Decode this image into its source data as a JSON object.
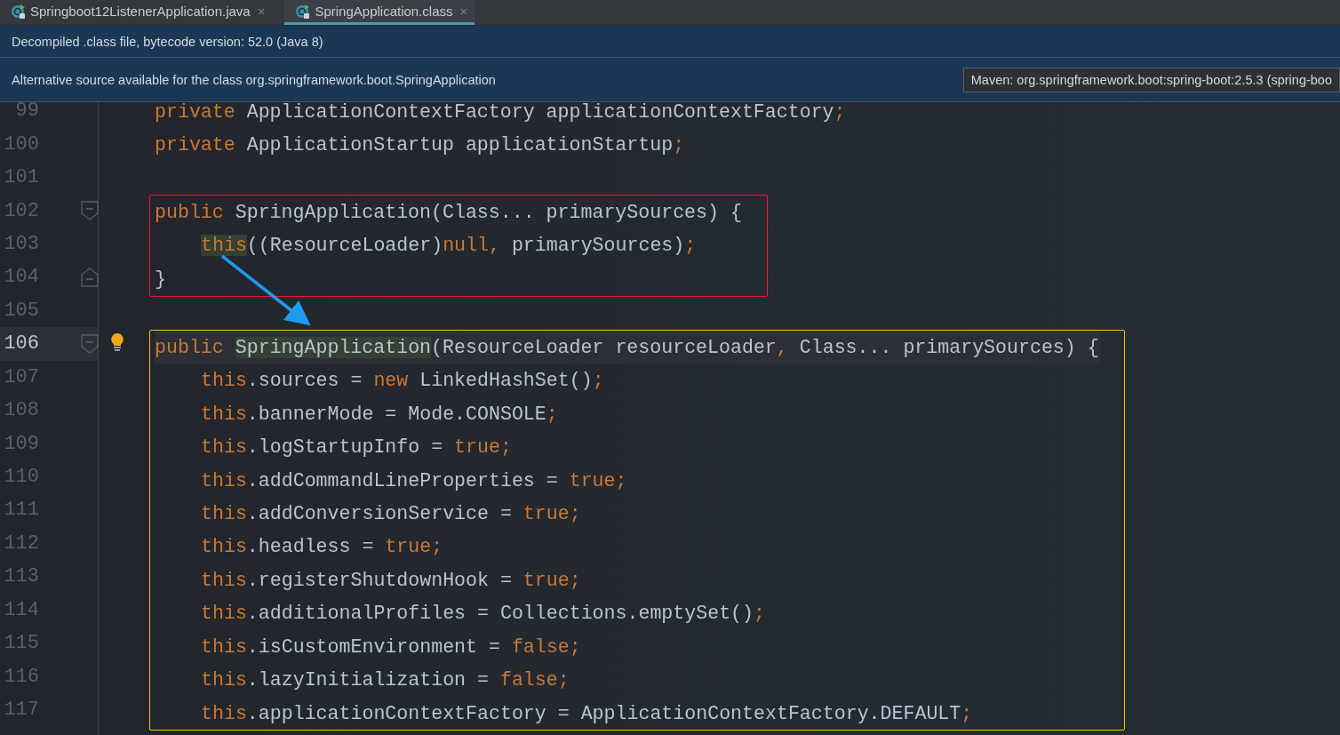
{
  "tabs": [
    {
      "label": "Springboot12ListenerApplication.java",
      "close": "×",
      "selected": false
    },
    {
      "label": "SpringApplication.class",
      "close": "×",
      "selected": true
    }
  ],
  "notice": "Decompiled .class file, bytecode version: 52.0 (Java 8)",
  "alternative": {
    "message": "Alternative source available for the class org.springframework.boot.SpringApplication",
    "source_choice": "Maven: org.springframework.boot:spring-boot:2.5.3 (spring-boo"
  },
  "editor": {
    "blocks": [
      {
        "lines": [
          {
            "number": "99",
            "current": false,
            "fold_start": false,
            "fold_end": false,
            "bulb": false,
            "tokens": [
              {
                "kind": "keyword",
                "text": "private"
              },
              {
                "kind": "plain",
                "text": " ApplicationContextFactory applicationContextFactory"
              },
              {
                "kind": "keyword",
                "text": ";"
              }
            ]
          },
          {
            "number": "100",
            "current": false,
            "fold_start": false,
            "fold_end": false,
            "bulb": false,
            "tokens": [
              {
                "kind": "keyword",
                "text": "private"
              },
              {
                "kind": "plain",
                "text": " ApplicationStartup applicationStartup"
              },
              {
                "kind": "keyword",
                "text": ";"
              }
            ]
          },
          {
            "number": "101",
            "current": false,
            "fold_start": false,
            "fold_end": false,
            "bulb": false
          }
        ]
      },
      {
        "color": "#e8192c",
        "lines": [
          {
            "number": "102",
            "current": false,
            "fold_start": true,
            "fold_end": false,
            "bulb": false,
            "tokens": [
              {
                "kind": "keyword",
                "text": "public"
              },
              {
                "kind": "plain",
                "text": " SpringApplication(Class... primarySources) {"
              }
            ],
            "children": [
              {
                "number": "103",
                "current": false,
                "fold_start": false,
                "fold_end": false,
                "bulb": false,
                "tokens": [
                  {
                    "kind": "keyword-match",
                    "text": "this"
                  },
                  {
                    "kind": "plain",
                    "text": "((ResourceLoader)"
                  },
                  {
                    "kind": "keyword",
                    "text": "null,"
                  },
                  {
                    "kind": "plain",
                    "text": " primarySources)"
                  },
                  {
                    "kind": "keyword",
                    "text": ";"
                  }
                ]
              }
            ]
          },
          {
            "number": "104",
            "current": false,
            "fold_start": false,
            "fold_end": true,
            "bulb": false,
            "tokens": [
              {
                "kind": "plain",
                "text": "}"
              }
            ]
          }
        ]
      },
      {
        "lines": [
          {
            "number": "105",
            "current": false,
            "fold_start": false,
            "fold_end": false,
            "bulb": false
          }
        ]
      },
      {
        "color": "#f5c400",
        "lines": [
          {
            "number": "106",
            "current": true,
            "fold_start": true,
            "fold_end": false,
            "bulb": true,
            "tokens": [
              {
                "kind": "keyword",
                "text": "public"
              },
              {
                "kind": "plain-match",
                "text": "SpringApplication"
              },
              {
                "kind": "plain",
                "text": "(ResourceLoader resourceLoader"
              },
              {
                "kind": "keyword",
                "text": ","
              },
              {
                "kind": "plain",
                "text": " Class... primarySources) {"
              }
            ],
            "children": [
              {
                "number": "107",
                "current": false,
                "fold_start": false,
                "fold_end": false,
                "bulb": false,
                "tokens": [
                  {
                    "kind": "keyword",
                    "text": "this"
                  },
                  {
                    "kind": "plain",
                    "text": ".sources = "
                  },
                  {
                    "kind": "keyword",
                    "text": "new"
                  },
                  {
                    "kind": "plain",
                    "text": " LinkedHashSet()"
                  },
                  {
                    "kind": "keyword",
                    "text": ";"
                  }
                ]
              },
              {
                "number": "108",
                "current": false,
                "fold_start": false,
                "fold_end": false,
                "bulb": false,
                "tokens": [
                  {
                    "kind": "keyword",
                    "text": "this"
                  },
                  {
                    "kind": "plain",
                    "text": ".bannerMode = Mode.CONSOLE"
                  },
                  {
                    "kind": "keyword",
                    "text": ";"
                  }
                ]
              },
              {
                "number": "109",
                "current": false,
                "fold_start": false,
                "fold_end": false,
                "bulb": false,
                "tokens": [
                  {
                    "kind": "keyword",
                    "text": "this"
                  },
                  {
                    "kind": "plain",
                    "text": ".logStartupInfo = "
                  },
                  {
                    "kind": "keyword",
                    "text": "true;"
                  }
                ]
              },
              {
                "number": "110",
                "current": false,
                "fold_start": false,
                "fold_end": false,
                "bulb": false,
                "tokens": [
                  {
                    "kind": "keyword",
                    "text": "this"
                  },
                  {
                    "kind": "plain",
                    "text": ".addCommandLineProperties = "
                  },
                  {
                    "kind": "keyword",
                    "text": "true;"
                  }
                ]
              },
              {
                "number": "111",
                "current": false,
                "fold_start": false,
                "fold_end": false,
                "bulb": false,
                "tokens": [
                  {
                    "kind": "keyword",
                    "text": "this"
                  },
                  {
                    "kind": "plain",
                    "text": ".addConversionService = "
                  },
                  {
                    "kind": "keyword",
                    "text": "true;"
                  }
                ]
              },
              {
                "number": "112",
                "current": false,
                "fold_start": false,
                "fold_end": false,
                "bulb": false,
                "tokens": [
                  {
                    "kind": "keyword",
                    "text": "this"
                  },
                  {
                    "kind": "plain",
                    "text": ".headless = "
                  },
                  {
                    "kind": "keyword",
                    "text": "true;"
                  }
                ]
              },
              {
                "number": "113",
                "current": false,
                "fold_start": false,
                "fold_end": false,
                "bulb": false,
                "tokens": [
                  {
                    "kind": "keyword",
                    "text": "this"
                  },
                  {
                    "kind": "plain",
                    "text": ".registerShutdownHook = "
                  },
                  {
                    "kind": "keyword",
                    "text": "true;"
                  }
                ]
              },
              {
                "number": "114",
                "current": false,
                "fold_start": false,
                "fold_end": false,
                "bulb": false,
                "tokens": [
                  {
                    "kind": "keyword",
                    "text": "this"
                  },
                  {
                    "kind": "plain",
                    "text": ".additionalProfiles = Collections.emptySet()"
                  },
                  {
                    "kind": "keyword",
                    "text": ";"
                  }
                ]
              },
              {
                "number": "115",
                "current": false,
                "fold_start": false,
                "fold_end": false,
                "bulb": false,
                "tokens": [
                  {
                    "kind": "keyword",
                    "text": "this"
                  },
                  {
                    "kind": "plain",
                    "text": ".isCustomEnvironment = "
                  },
                  {
                    "kind": "keyword",
                    "text": "false;"
                  }
                ]
              },
              {
                "number": "116",
                "current": false,
                "fold_start": false,
                "fold_end": false,
                "bulb": false,
                "tokens": [
                  {
                    "kind": "keyword",
                    "text": "this"
                  },
                  {
                    "kind": "plain",
                    "text": ".lazyInitialization = "
                  },
                  {
                    "kind": "keyword",
                    "text": "false;"
                  }
                ]
              },
              {
                "number": "117",
                "current": false,
                "fold_start": false,
                "fold_end": false,
                "bulb": false,
                "tokens": [
                  {
                    "kind": "keyword",
                    "text": "this"
                  },
                  {
                    "kind": "plain",
                    "text": ".applicationContextFactory = ApplicationContextFactory.DEFAULT"
                  },
                  {
                    "kind": "keyword",
                    "text": ";"
                  }
                ]
              }
            ]
          }
        ]
      }
    ]
  }
}
